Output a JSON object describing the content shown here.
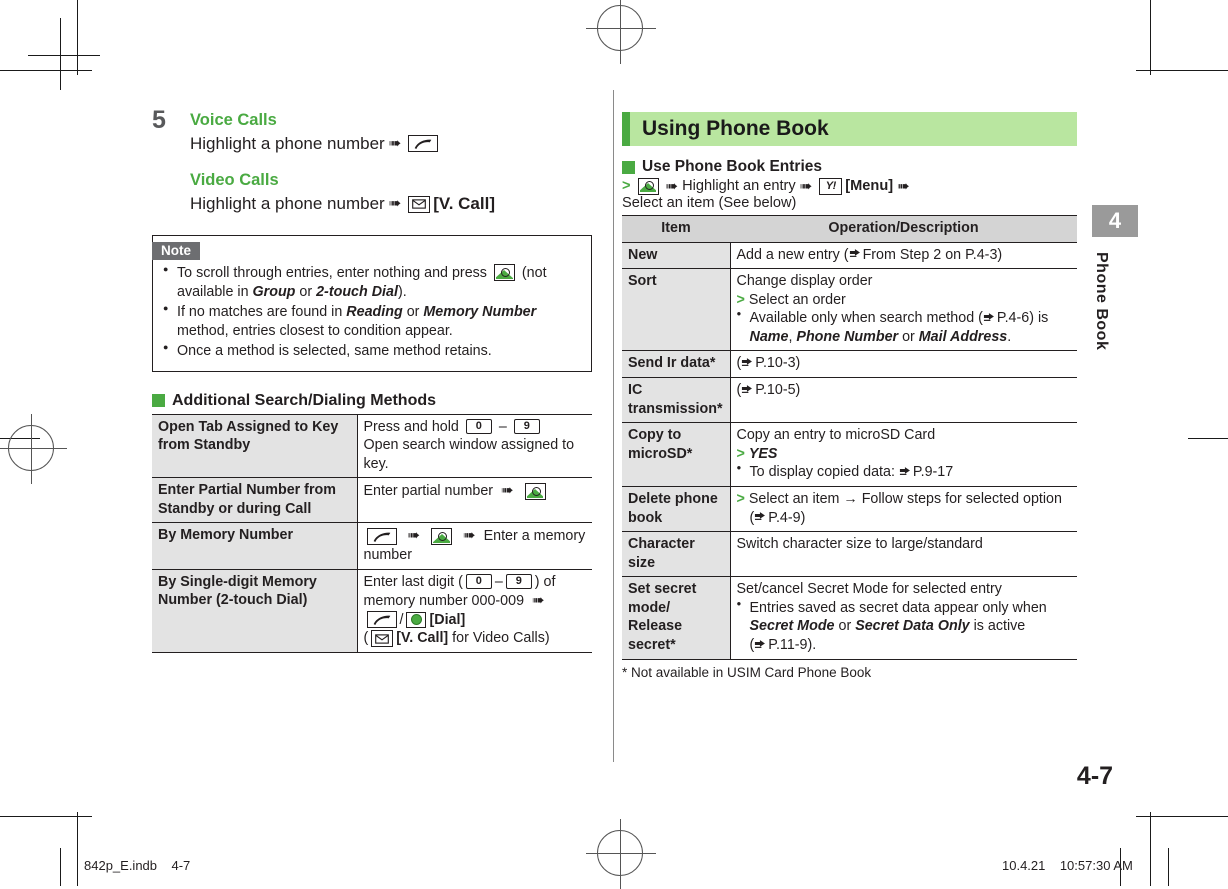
{
  "document": {
    "page_number": "4-7",
    "side_tab": {
      "chapter_number": "4",
      "chapter_title": "Phone Book"
    },
    "footer": {
      "file_name": "842p_E.indb",
      "page_ref": "4-7",
      "date": "10.4.21",
      "time": "10:57:30 AM"
    }
  },
  "left_column": {
    "step": {
      "number": "5",
      "voice_heading": "Voice Calls",
      "voice_text": "Highlight a phone number",
      "video_heading": "Video Calls",
      "video_text": "Highlight a phone number",
      "video_key_label": "[V. Call]"
    },
    "note": {
      "title": "Note",
      "items": [
        {
          "pre": "To scroll through entries, enter nothing and press",
          "post_a": "(not available in",
          "em1": "Group",
          "mid": "or",
          "em2": "2-touch Dial",
          "post_b": ")."
        },
        {
          "pre": "If no matches are found in",
          "em1": "Reading",
          "mid": "or",
          "em2": "Memory Number",
          "post": "method, entries closest to condition appear."
        },
        {
          "text": "Once a method is selected, same method retains."
        }
      ]
    },
    "methods_heading": "Additional Search/Dialing Methods",
    "methods_table": {
      "rows": [
        {
          "key": "Open Tab Assigned to Key from Standby",
          "value_pre": "Press and hold",
          "key_a": "0",
          "dash": "–",
          "key_b": "9",
          "value_post": "Open search window assigned to key."
        },
        {
          "key": "Enter Partial Number from Standby or during Call",
          "value_pre": "Enter partial number"
        },
        {
          "key": "By Memory Number",
          "value_post": "Enter a memory number"
        },
        {
          "key": "By Single-digit Memory Number (2-touch Dial)",
          "value_pre": "Enter last digit (",
          "key_a": "0",
          "dash": "–",
          "key_b": "9",
          "value_mid": ") of memory number 000-009",
          "dial_label": "[Dial]",
          "video_note_open": "(",
          "video_note_label": "[V. Call]",
          "video_note_tail": "for Video Calls)"
        }
      ]
    }
  },
  "right_column": {
    "banner_title": "Using Phone Book",
    "subsection_heading": "Use Phone Book Entries",
    "procedure": {
      "step1": "Highlight an entry",
      "menu_label": "[Menu]",
      "step2": "Select an item (See below)"
    },
    "table": {
      "headers": {
        "item": "Item",
        "operation": "Operation/Description"
      },
      "rows": [
        {
          "item": "New",
          "lines": [
            {
              "type": "text",
              "text": "Add a new entry (",
              "ref": "From Step 2 on P.4-3",
              "tail": ")"
            }
          ]
        },
        {
          "item": "Sort",
          "lines": [
            {
              "type": "text",
              "text": "Change display order"
            },
            {
              "type": "chev",
              "text": "Select an order"
            },
            {
              "type": "bullet",
              "text": "Available only when search method (",
              "ref": "P.4-6",
              "tail": ") is",
              "em_list": [
                "Name",
                "Phone Number",
                "Mail Address"
              ],
              "em_sep": ", ",
              "em_last_sep": " or ",
              "end": "."
            }
          ]
        },
        {
          "item": "Send Ir data*",
          "lines": [
            {
              "type": "text",
              "text": "(",
              "ref": "P.10-3",
              "tail": ")"
            }
          ]
        },
        {
          "item": "IC transmission*",
          "lines": [
            {
              "type": "text",
              "text": "(",
              "ref": "P.10-5",
              "tail": ")"
            }
          ]
        },
        {
          "item": "Copy to microSD*",
          "lines": [
            {
              "type": "text",
              "text": "Copy an entry to microSD Card"
            },
            {
              "type": "chev",
              "em": "YES"
            },
            {
              "type": "bullet",
              "text": "To display copied data: ",
              "ref": "P.9-17"
            }
          ]
        },
        {
          "item": "Delete phone book",
          "lines": [
            {
              "type": "chev",
              "text": "Select an item → Follow steps for selected option"
            },
            {
              "type": "indent",
              "text": "(",
              "ref": "P.4-9",
              "tail": ")"
            }
          ]
        },
        {
          "item": "Character size",
          "lines": [
            {
              "type": "text",
              "text": "Switch character size to large/standard"
            }
          ]
        },
        {
          "item": "Set secret mode/ Release secret*",
          "lines": [
            {
              "type": "text",
              "text": "Set/cancel Secret Mode for selected entry"
            },
            {
              "type": "bullet",
              "text": "Entries saved as secret data appear only when"
            },
            {
              "type": "indent_em",
              "em_list": [
                "Secret Mode",
                "Secret Data Only"
              ],
              "join": " or ",
              "tail": " is active"
            },
            {
              "type": "indent",
              "text": "(",
              "ref": "P.11-9",
              "tail": ")."
            }
          ]
        }
      ]
    },
    "footnote": "* Not available in USIM Card Phone Book"
  },
  "colors": {
    "accent_green": "#4aaa42",
    "banner_bg": "#b9e6a0",
    "table_key_bg": "#e3e3e3",
    "table_header_bg": "#d4d4d4",
    "note_tab_bg": "#6d6e71",
    "sidetab_bg": "#9a9a9a"
  }
}
